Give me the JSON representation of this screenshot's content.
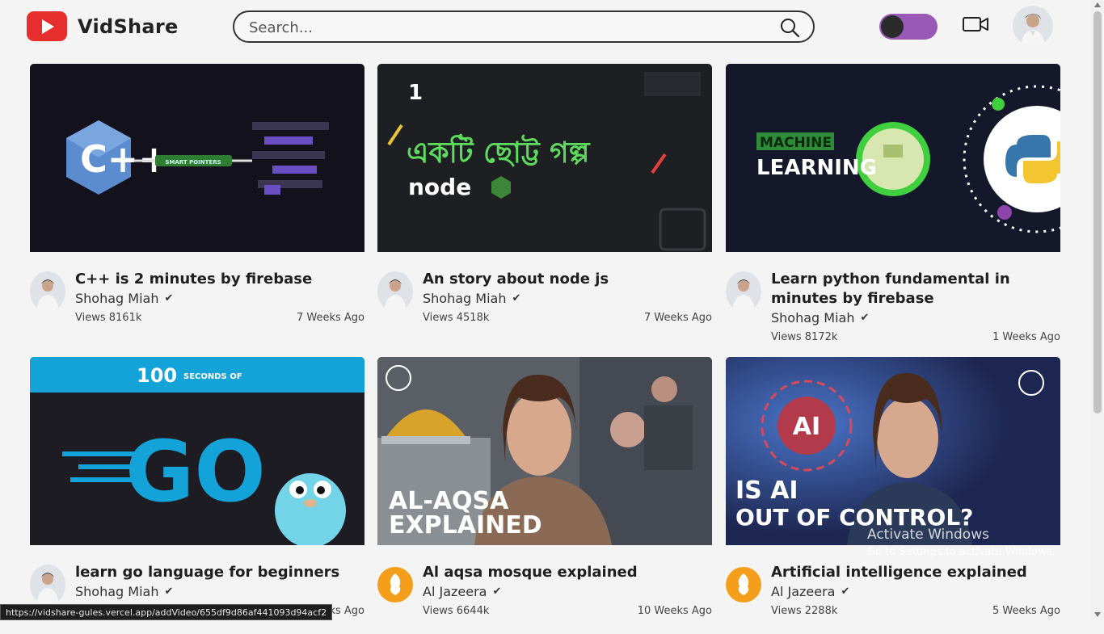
{
  "app": {
    "name": "VidShare",
    "accent": "#e62e2e",
    "toggle_color": "#9b59b6"
  },
  "search": {
    "placeholder": "Search...",
    "value": ""
  },
  "icons": {
    "search": "search-icon",
    "camera": "video-camera-icon",
    "toggle": "theme-toggle",
    "verified": "check-icon"
  },
  "videos": [
    {
      "title": "C++ is 2 minutes by firebase",
      "channel": "Shohag Miah",
      "views": "Views 8161k",
      "ago": "7 Weeks Ago",
      "thumb_text": "SMART POINTERS",
      "thumb_logo": "C++"
    },
    {
      "title": "An story about node js",
      "channel": "Shohag Miah",
      "views": "Views 4518k",
      "ago": "7 Weeks Ago",
      "thumb_text": "একটি ছোট্ট গল্প",
      "thumb_logo": "node",
      "thumb_num": "1"
    },
    {
      "title": "Learn python fundamental in minutes by firebase",
      "channel": "Shohag Miah",
      "views": "Views 8172k",
      "ago": "1 Weeks Ago",
      "thumb_text": "MACHINE",
      "thumb_text2": "LEARNING"
    },
    {
      "title": "learn go language for beginners",
      "channel": "Shohag Miah",
      "views": "",
      "ago": "eeks Ago",
      "thumb_text": "100",
      "thumb_text2": "SECONDS OF",
      "thumb_logo": "GO"
    },
    {
      "title": "Al aqsa mosque explained",
      "channel": "Al Jazeera",
      "views": "Views 6644k",
      "ago": "10 Weeks Ago",
      "thumb_text": "AL-AQSA",
      "thumb_text2": "EXPLAINED"
    },
    {
      "title": "Artificial intelligence explained",
      "channel": "Al Jazeera",
      "views": "Views 2288k",
      "ago": "5 Weeks Ago",
      "thumb_text": "IS AI",
      "thumb_text2": "OUT OF CONTROL?",
      "thumb_logo": "AI"
    }
  ],
  "status_url": "https://vidshare-gules.vercel.app/addVideo/655df9d86af441093d94acf2",
  "watermark": {
    "line1": "Activate Windows",
    "line2": "Go to Settings to activate Windows."
  }
}
